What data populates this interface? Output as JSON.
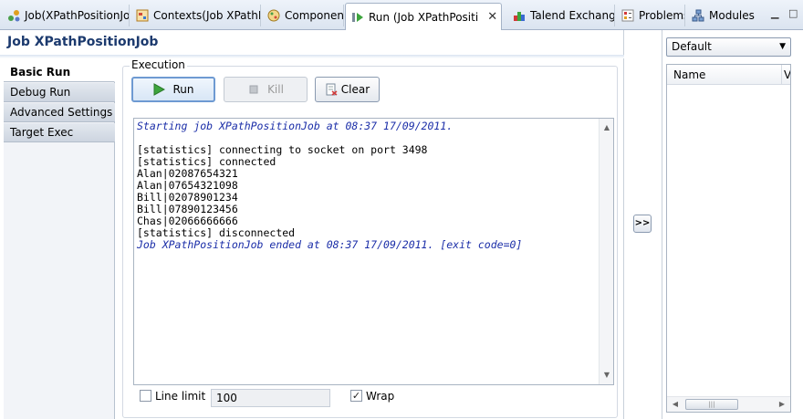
{
  "tabs": [
    {
      "label": "Job(XPathPositionJo",
      "icon": "job-icon"
    },
    {
      "label": "Contexts(Job XPathPo",
      "icon": "contexts-icon"
    },
    {
      "label": "Component",
      "icon": "component-icon"
    },
    {
      "label": "Run (Job XPathPositi",
      "icon": "run-icon",
      "active": true
    },
    {
      "label": "Talend Exchange",
      "icon": "exchange-icon"
    },
    {
      "label": "Problems",
      "icon": "problems-icon"
    },
    {
      "label": "Modules",
      "icon": "modules-icon"
    }
  ],
  "view_controls": {
    "minimize": "▁",
    "maximize": "□"
  },
  "job_title": "Job XPathPositionJob",
  "sidenav": [
    "Basic Run",
    "Debug Run",
    "Advanced Settings",
    "Target Exec"
  ],
  "execution": {
    "group_label": "Execution",
    "run_label": "Run",
    "kill_label": "Kill",
    "clear_label": "Clear"
  },
  "console_lines": [
    {
      "type": "info",
      "text": "Starting job XPathPositionJob at 08:37 17/09/2011."
    },
    {
      "type": "out",
      "text": ""
    },
    {
      "type": "out",
      "text": "[statistics] connecting to socket on port 3498"
    },
    {
      "type": "out",
      "text": "[statistics] connected"
    },
    {
      "type": "out",
      "text": "Alan|02087654321"
    },
    {
      "type": "out",
      "text": "Alan|07654321098"
    },
    {
      "type": "out",
      "text": "Bill|02078901234"
    },
    {
      "type": "out",
      "text": "Bill|07890123456"
    },
    {
      "type": "out",
      "text": "Chas|02066666666"
    },
    {
      "type": "out",
      "text": "[statistics] disconnected"
    },
    {
      "type": "info",
      "text": "Job XPathPositionJob ended at 08:37 17/09/2011. [exit code=0]"
    }
  ],
  "options": {
    "line_limit_label": "Line limit",
    "line_limit_checked": false,
    "line_limit_value": "100",
    "wrap_label": "Wrap",
    "wrap_checked": true
  },
  "toggle_label": ">>",
  "context": {
    "selected": "Default",
    "columns": [
      "Name",
      "V"
    ]
  },
  "colors": {
    "accent": "#1c3a6e",
    "console_info": "#1b2ea8"
  }
}
